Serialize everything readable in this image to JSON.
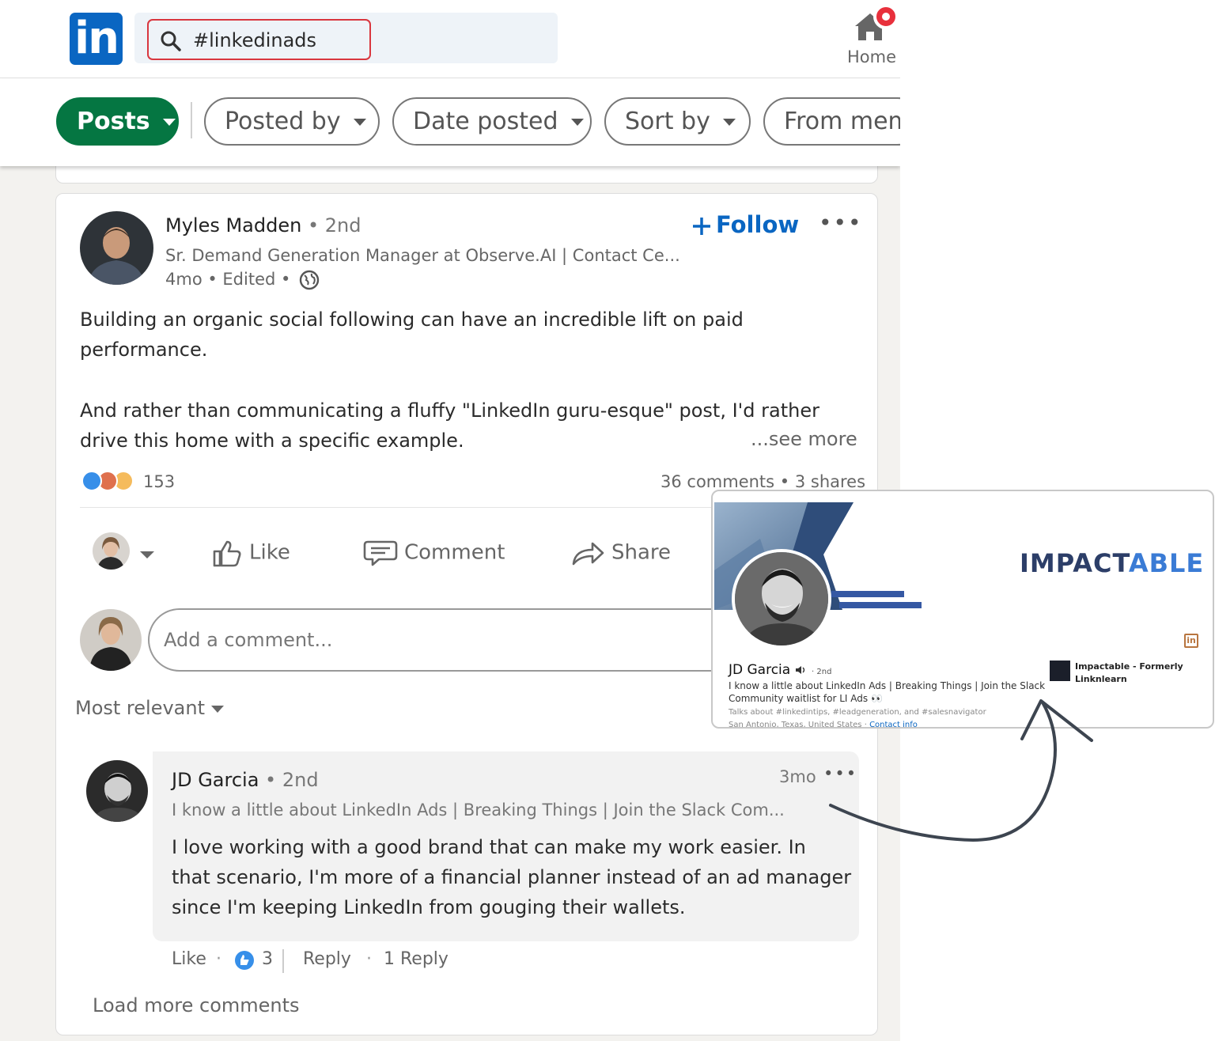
{
  "header": {
    "logo_text": "in",
    "search": {
      "value": "#linkedinads"
    },
    "nav": {
      "home_label": "Home"
    }
  },
  "filters": {
    "items": [
      {
        "label": "Posts",
        "active": true
      },
      {
        "label": "Posted by",
        "active": false
      },
      {
        "label": "Date posted",
        "active": false
      },
      {
        "label": "Sort by",
        "active": false
      },
      {
        "label": "From mem",
        "active": false
      }
    ]
  },
  "post": {
    "author": {
      "name": "Myles Madden",
      "degree": "• 2nd",
      "headline": "Sr. Demand Generation Manager at Observe.AI | Contact Ce...",
      "meta": "4mo • Edited •"
    },
    "follow_label": "Follow",
    "more_label": "•••",
    "text_lines": [
      "Building an organic social following can have an incredible lift on paid",
      "performance.",
      "And rather than communicating a fluffy \"LinkedIn guru-esque\" post, I'd rather",
      "drive this home with a specific example."
    ],
    "see_more": "...see more",
    "reaction_count": "153",
    "comments_shares": "36 comments • 3 shares",
    "actions": {
      "like": "Like",
      "comment": "Comment",
      "share": "Share"
    },
    "comment_placeholder": "Add a comment...",
    "sort_label": "Most relevant"
  },
  "comment": {
    "name": "JD Garcia",
    "degree": "• 2nd",
    "headline": "I know a little about LinkedIn Ads | Breaking Things | Join the Slack Com...",
    "time": "3mo",
    "more": "•••",
    "text_lines": [
      "I love working with a good brand that can make my work easier. In",
      "that scenario, I'm more of a financial planner instead of an ad manager",
      "since I'm keeping LinkedIn from gouging their wallets."
    ],
    "like_label": "Like",
    "like_count": "3",
    "reply_label": "Reply",
    "replies": "1 Reply",
    "load_more": "Load more comments"
  },
  "profile_card": {
    "logo_part1": "IMPACT",
    "logo_part2": "ABLE",
    "name": "JD Garcia",
    "degree": "· 2nd",
    "headline_lines": [
      "I know a little about LinkedIn Ads | Breaking Things | Join the Slack",
      "Community waitlist for LI Ads 👀"
    ],
    "talks_about": "Talks about #linkedintips, #leadgeneration, and #salesnavigator",
    "location": "San Antonio, Texas, United States ·",
    "contact_info": "Contact info",
    "company_lines": [
      "Impactable - Formerly",
      "Linknlearn"
    ]
  },
  "colors": {
    "brand_blue": "#0a66c2",
    "posts_green": "#057642",
    "badge_red": "#e8303c",
    "search_border": "#d9363e",
    "arrow": "#3d4550"
  }
}
